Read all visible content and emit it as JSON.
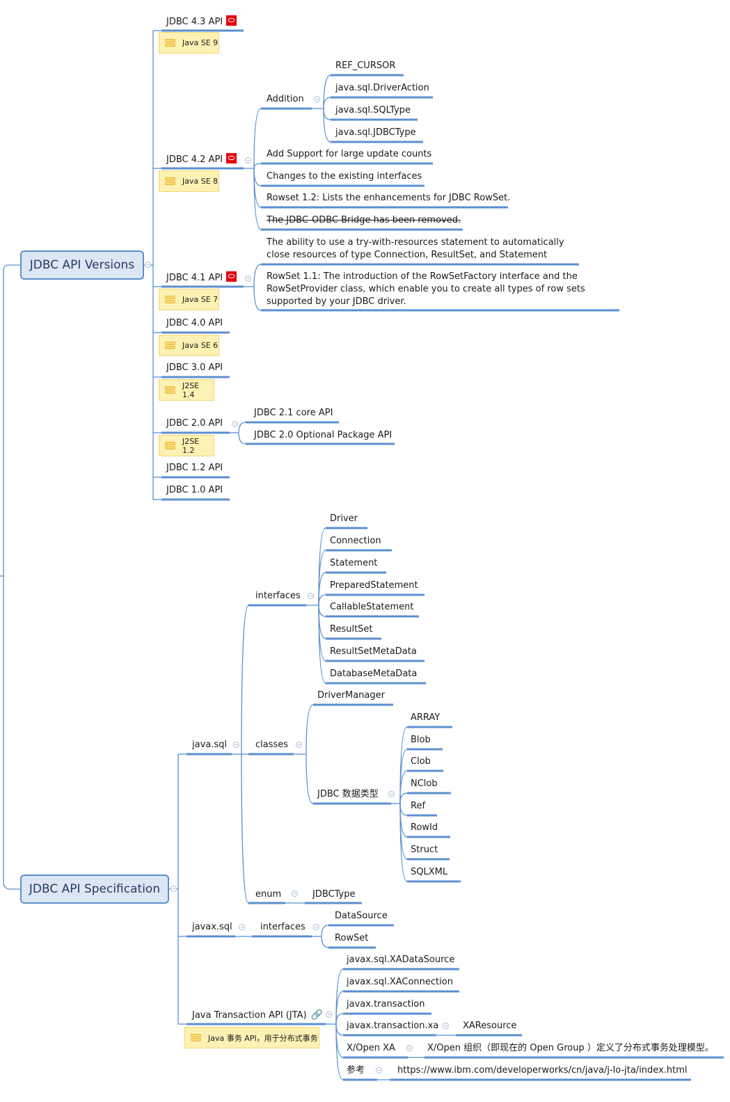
{
  "roots": {
    "versions": "JDBC API Versions",
    "spec": "JDBC API Specification"
  },
  "versions": [
    {
      "label": "JDBC 4.3 API",
      "oracle_icon": true,
      "note": "Java SE 9"
    },
    {
      "label": "JDBC 4.2 API",
      "oracle_icon": true,
      "note": "Java SE 8",
      "children": [
        {
          "label": "Addition",
          "children": [
            "REF_CURSOR",
            "java.sql.DriverAction",
            "java.sql.SQLType",
            "java.sql.JDBCType"
          ]
        },
        {
          "label": "Add Support for large update counts"
        },
        {
          "label": "Changes to the existing interfaces"
        },
        {
          "label": "Rowset 1.2: Lists the enhancements for JDBC RowSet."
        },
        {
          "label": "The JDBC-ODBC Bridge has been removed.",
          "strikethrough": true
        }
      ]
    },
    {
      "label": "JDBC 4.1 API",
      "oracle_icon": true,
      "note": "Java SE 7",
      "children": [
        {
          "label": "The ability to use a try-with-resources statement to automatically close resources of type Connection, ResultSet, and Statement"
        },
        {
          "label": "RowSet 1.1: The introduction of the RowSetFactory interface and the RowSetProvider class, which enable you to create all types of row sets supported by your JDBC driver."
        }
      ]
    },
    {
      "label": "JDBC 4.0 API",
      "note": "Java SE 6"
    },
    {
      "label": "JDBC 3.0 API",
      "note": "J2SE 1.4"
    },
    {
      "label": "JDBC 2.0 API",
      "note": "J2SE 1.2",
      "children": [
        {
          "label": "JDBC 2.1 core API"
        },
        {
          "label": "JDBC 2.0 Optional Package API"
        }
      ]
    },
    {
      "label": "JDBC 1.2 API"
    },
    {
      "label": "JDBC 1.0 API"
    }
  ],
  "spec": {
    "java_sql": {
      "label": "java.sql",
      "interfaces": {
        "label": "interfaces",
        "items": [
          "Driver",
          "Connection",
          "Statement",
          "PreparedStatement",
          "CallableStatement",
          "ResultSet",
          "ResultSetMetaData",
          "DatabaseMetaData"
        ]
      },
      "classes": {
        "label": "classes",
        "driver_manager": "DriverManager",
        "data_types": {
          "label": "JDBC 数据类型",
          "items": [
            "ARRAY",
            "Blob",
            "Clob",
            "NClob",
            "Ref",
            "RowId",
            "Struct",
            "SQLXML"
          ]
        }
      },
      "enum": {
        "label": "enum",
        "item": "JDBCType"
      }
    },
    "javax_sql": {
      "label": "javax.sql",
      "interfaces": {
        "label": "interfaces",
        "items": [
          "DataSource",
          "RowSet"
        ]
      }
    },
    "jta": {
      "label": "Java Transaction API (JTA)",
      "note": "Java 事务 API，用于分布式事务",
      "items": [
        {
          "label": "javax.sql.XADataSource"
        },
        {
          "label": "javax.sql.XAConnection"
        },
        {
          "label": "javax.transaction"
        },
        {
          "label": "javax.transaction.xa",
          "child": "XAResource"
        },
        {
          "label": "X/Open XA",
          "child": "X/Open 组织（即现在的 Open Group ）定义了分布式事务处理模型。"
        },
        {
          "label": "参考",
          "child": "https://www.ibm.com/developerworks/cn/java/j-lo-jta/index.html"
        }
      ]
    }
  },
  "colors": {
    "line": "#5b8fd0",
    "root_fill": "#dce6f4",
    "note_fill": "#fdf1b3",
    "oracle_red": "#e4000f"
  }
}
